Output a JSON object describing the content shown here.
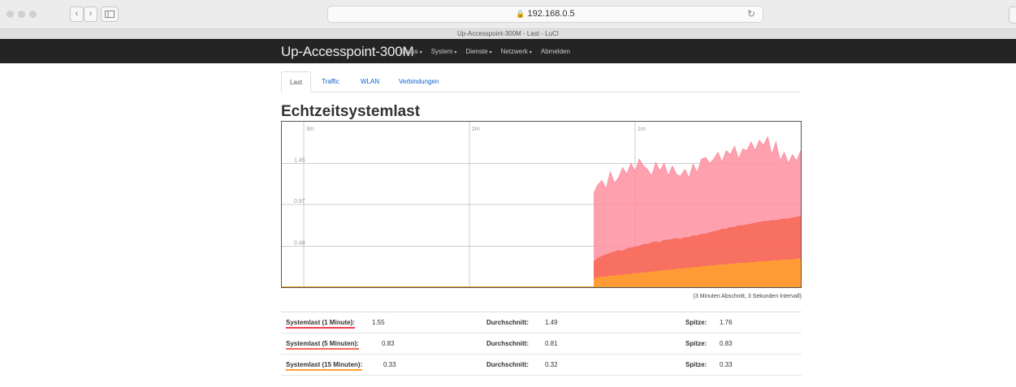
{
  "browser": {
    "url": "192.168.0.5",
    "tab_title": "Up-Accesspoint-300M - Last - LuCI",
    "back_glyph": "‹",
    "forward_glyph": "›"
  },
  "header": {
    "brand": "Up-Accesspoint-300M",
    "menu": [
      {
        "label": "Status"
      },
      {
        "label": "System"
      },
      {
        "label": "Dienste"
      },
      {
        "label": "Netzwerk"
      },
      {
        "label": "Abmelden"
      }
    ]
  },
  "tabs": [
    {
      "label": "Last",
      "active": true
    },
    {
      "label": "Traffic"
    },
    {
      "label": "WLAN"
    },
    {
      "label": "Verbindungen"
    }
  ],
  "page": {
    "title": "Echtzeitsystemlast",
    "caption": "(3 Minuten Abschnitt, 3 Sekunden Intervall)"
  },
  "chart_data": {
    "type": "area",
    "x_ticks": [
      "3m",
      "2m",
      "1m"
    ],
    "y_ticks": [
      "1.45",
      "0.97",
      "0.48"
    ],
    "ylim": [
      0,
      1.94
    ],
    "x_range_minutes": [
      3,
      0
    ],
    "series": [
      {
        "name": "Systemlast (1 Minute)",
        "color": "#ff8fa0",
        "values": [
          1.1,
          1.2,
          1.25,
          1.15,
          1.35,
          1.22,
          1.28,
          1.4,
          1.32,
          1.45,
          1.35,
          1.5,
          1.42,
          1.38,
          1.3,
          1.46,
          1.36,
          1.45,
          1.3,
          1.42,
          1.32,
          1.3,
          1.38,
          1.28,
          1.44,
          1.34,
          1.5,
          1.52,
          1.45,
          1.5,
          1.58,
          1.46,
          1.6,
          1.55,
          1.65,
          1.5,
          1.62,
          1.6,
          1.7,
          1.6,
          1.72,
          1.66,
          1.76,
          1.55,
          1.7,
          1.48,
          1.58,
          1.45,
          1.55,
          1.48,
          1.6
        ]
      },
      {
        "name": "Systemlast (5 Minuten)",
        "color": "#f76a5a",
        "values": [
          0.3,
          0.34,
          0.36,
          0.38,
          0.4,
          0.41,
          0.43,
          0.42,
          0.45,
          0.46,
          0.47,
          0.48,
          0.5,
          0.5,
          0.52,
          0.53,
          0.52,
          0.55,
          0.55,
          0.56,
          0.57,
          0.56,
          0.58,
          0.58,
          0.6,
          0.6,
          0.62,
          0.62,
          0.64,
          0.65,
          0.66,
          0.68,
          0.68,
          0.7,
          0.7,
          0.72,
          0.72,
          0.73,
          0.74,
          0.75,
          0.76,
          0.77,
          0.77,
          0.78,
          0.78,
          0.79,
          0.8,
          0.8,
          0.81,
          0.82,
          0.83
        ]
      },
      {
        "name": "Systemlast (15 Minuten)",
        "color": "#ffa030",
        "values": [
          0.1,
          0.11,
          0.12,
          0.12,
          0.13,
          0.13,
          0.14,
          0.14,
          0.15,
          0.15,
          0.16,
          0.16,
          0.17,
          0.17,
          0.18,
          0.18,
          0.19,
          0.19,
          0.2,
          0.2,
          0.21,
          0.21,
          0.22,
          0.22,
          0.23,
          0.23,
          0.24,
          0.24,
          0.25,
          0.25,
          0.26,
          0.26,
          0.26,
          0.27,
          0.27,
          0.28,
          0.28,
          0.28,
          0.29,
          0.29,
          0.3,
          0.3,
          0.3,
          0.31,
          0.31,
          0.31,
          0.32,
          0.32,
          0.32,
          0.33,
          0.33
        ]
      }
    ],
    "data_start_minutes_ago": 1.25
  },
  "stats": [
    {
      "label": "Systemlast (1 Minute):",
      "value": "1.55",
      "avg_label": "Durchschnitt:",
      "avg": "1.49",
      "peak_label": "Spitze:",
      "peak": "1.76",
      "color": "#f04050"
    },
    {
      "label": "Systemlast (5 Minuten):",
      "value": "0.83",
      "avg_label": "Durchschnitt:",
      "avg": "0.81",
      "peak_label": "Spitze:",
      "peak": "0.83",
      "color": "#f76a5a"
    },
    {
      "label": "Systemlast (15 Minuten):",
      "value": "0.33",
      "avg_label": "Durchschnitt:",
      "avg": "0.32",
      "peak_label": "Spitze:",
      "peak": "0.33",
      "color": "#ffa030"
    }
  ]
}
